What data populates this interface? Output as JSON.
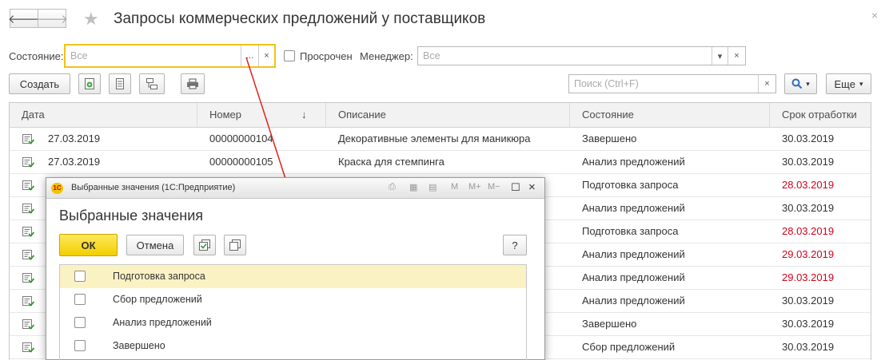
{
  "header": {
    "title": "Запросы коммерческих предложений у поставщиков",
    "back_glyph": "🡐",
    "forward_glyph": "🡒",
    "close_glyph": "×"
  },
  "filters": {
    "state_label": "Состояние:",
    "state_placeholder": "Все",
    "state_select_glyph": "...",
    "state_clear_glyph": "×",
    "overdue_label": "Просрочен",
    "manager_label": "Менеджер:",
    "manager_placeholder": "Все",
    "manager_dropdown_glyph": "▾",
    "manager_clear_glyph": "×"
  },
  "toolbar": {
    "create_label": "Создать",
    "search_placeholder": "Поиск (Ctrl+F)",
    "search_clear_glyph": "×",
    "more_label": "Еще",
    "more_glyph": "▾"
  },
  "table": {
    "columns": [
      "Дата",
      "Номер",
      "Описание",
      "Состояние",
      "Срок отработки"
    ],
    "sort_glyph": "↓",
    "rows": [
      {
        "date": "27.03.2019",
        "number": "00000000104",
        "description": "Декоративные элементы для маникюра",
        "state": "Завершено",
        "deadline": "30.03.2019",
        "overdue": false
      },
      {
        "date": "27.03.2019",
        "number": "00000000105",
        "description": "Краска для стемпинга",
        "state": "Анализ предложений",
        "deadline": "30.03.2019",
        "overdue": false
      },
      {
        "date": "",
        "number": "",
        "description": "",
        "state": "Подготовка запроса",
        "deadline": "28.03.2019",
        "overdue": true
      },
      {
        "date": "",
        "number": "",
        "description": "",
        "state": "Анализ предложений",
        "deadline": "30.03.2019",
        "overdue": false
      },
      {
        "date": "",
        "number": "",
        "description": "",
        "state": "Подготовка запроса",
        "deadline": "28.03.2019",
        "overdue": true
      },
      {
        "date": "",
        "number": "",
        "description": "",
        "state": "Анализ предложений",
        "deadline": "29.03.2019",
        "overdue": true
      },
      {
        "date": "",
        "number": "",
        "description": "",
        "state": "Анализ предложений",
        "deadline": "29.03.2019",
        "overdue": true
      },
      {
        "date": "",
        "number": "",
        "description": "",
        "state": "Анализ предложений",
        "deadline": "30.03.2019",
        "overdue": false
      },
      {
        "date": "",
        "number": "",
        "description": "",
        "state": "Завершено",
        "deadline": "30.03.2019",
        "overdue": false
      },
      {
        "date": "",
        "number": "",
        "description": "",
        "state": "Сбор предложений",
        "deadline": "30.03.2019",
        "overdue": false
      }
    ]
  },
  "dialog": {
    "window_title": "Выбранные значения  (1С:Предприятие)",
    "logo_text": "1С",
    "toolbar_m": "M",
    "toolbar_mplus": "M+",
    "toolbar_mminus": "M−",
    "close_glyph": "×",
    "heading": "Выбранные значения",
    "ok_label": "ОК",
    "cancel_label": "Отмена",
    "help_label": "?",
    "items": [
      {
        "label": "Подготовка запроса",
        "checked": false,
        "selected": true
      },
      {
        "label": "Сбор предложений",
        "checked": false,
        "selected": false
      },
      {
        "label": "Анализ предложений",
        "checked": false,
        "selected": false
      },
      {
        "label": "Завершено",
        "checked": false,
        "selected": false
      }
    ]
  },
  "colors": {
    "overdue": "#d0021b",
    "accent_yellow": "#f2cf00",
    "selected_row": "#fbf2c4",
    "arrow": "#e0241b",
    "focus_border": "#f0c21a"
  }
}
